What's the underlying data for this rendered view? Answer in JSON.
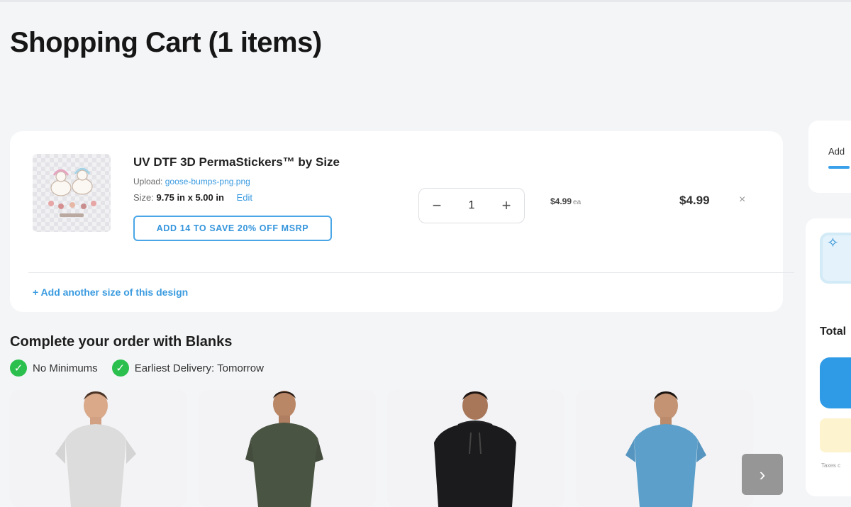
{
  "page": {
    "title": "Shopping Cart (1 items)"
  },
  "cart_item": {
    "name": "UV DTF 3D PermaStickers™ by Size",
    "upload_label": "Upload:",
    "upload_file": "goose-bumps-png.png",
    "size_label": "Size:",
    "size_value": "9.75 in x 5.00 in",
    "edit_label": "Edit",
    "promo_label": "ADD 14 TO SAVE 20% OFF MSRP",
    "quantity": "1",
    "minus_glyph": "−",
    "plus_glyph": "+",
    "unit_price": "$4.99",
    "unit_suffix": "ea",
    "line_total": "$4.99",
    "remove_glyph": "×",
    "add_size_label": "+ Add another size of this design"
  },
  "blanks": {
    "title": "Complete your order with Blanks",
    "badges": [
      {
        "label": "No Minimums",
        "icon": "check-circle-icon"
      },
      {
        "label": "Earliest Delivery: Tomorrow",
        "icon": "check-circle-icon"
      }
    ],
    "products": [
      {
        "name": "white-tshirt-model",
        "shirt_color": "#dcdcdc"
      },
      {
        "name": "olive-tshirt-model",
        "shirt_color": "#4a5443"
      },
      {
        "name": "black-hoodie-model",
        "shirt_color": "#1b1b1d"
      },
      {
        "name": "blue-tshirt-model",
        "shirt_color": "#5b9fca"
      }
    ],
    "next_glyph": "›"
  },
  "sidebar": {
    "tab_label": "Add",
    "spark_glyph": "✧",
    "total_label": "Total",
    "tiny_note": "Taxes c"
  },
  "colors": {
    "accent": "#3a9be0",
    "success": "#2bc04d",
    "background": "#f4f5f7"
  }
}
